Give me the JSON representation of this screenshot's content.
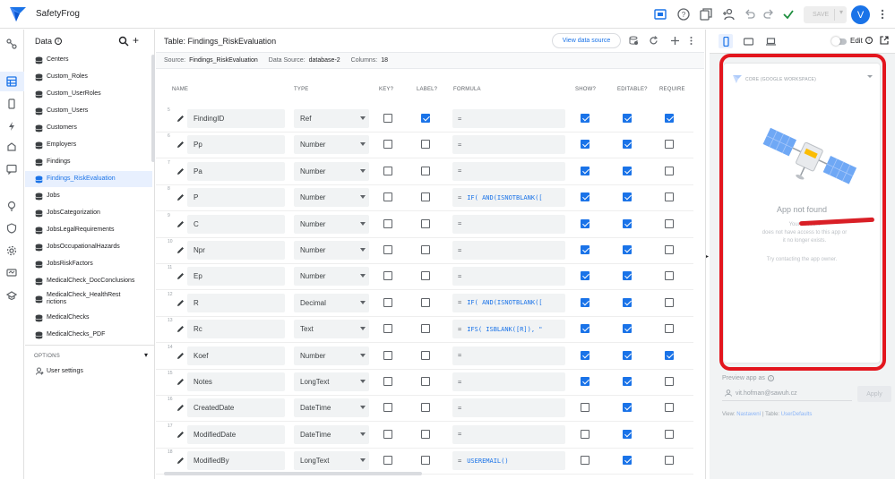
{
  "app": {
    "title": "SafetyFrog",
    "save_label": "SAVE",
    "avatar_letter": "V"
  },
  "data_panel": {
    "title": "Data",
    "tables": [
      "Centers",
      "Custom_Roles",
      "Custom_UserRoles",
      "Custom_Users",
      "Customers",
      "Employers",
      "Findings",
      "Findings_RiskEvaluation",
      "Jobs",
      "JobsCategorization",
      "JobsLegalRequirements",
      "JobsOccupationalHazards",
      "JobsRiskFactors",
      "MedicalCheck_DocConclusions",
      "MedicalCheck_HealthRestrictions",
      "MedicalChecks",
      "MedicalChecks_PDF"
    ],
    "active_table": "Findings_RiskEvaluation",
    "options_label": "OPTIONS",
    "user_settings_label": "User settings"
  },
  "main": {
    "title": "Table: Findings_RiskEvaluation",
    "view_source_label": "View data source",
    "source_label": "Source:",
    "source_value": "Findings_RiskEvaluation",
    "datasource_label": "Data Source:",
    "datasource_value": "database-2",
    "columns_label": "Columns:",
    "columns_value": "18",
    "headers": {
      "name": "NAME",
      "type": "TYPE",
      "key": "KEY?",
      "label": "LABEL?",
      "formula": "FORMULA",
      "show": "SHOW?",
      "editable": "EDITABLE?",
      "required": "REQUIRE"
    },
    "rows": [
      {
        "num": "5",
        "name": "FindingID",
        "type": "Ref",
        "key": false,
        "label": true,
        "formula": "",
        "show": true,
        "editable": true,
        "required": true
      },
      {
        "num": "6",
        "name": "Pp",
        "type": "Number",
        "key": false,
        "label": false,
        "formula": "",
        "show": true,
        "editable": true,
        "required": false
      },
      {
        "num": "7",
        "name": "Pa",
        "type": "Number",
        "key": false,
        "label": false,
        "formula": "",
        "show": true,
        "editable": true,
        "required": false
      },
      {
        "num": "8",
        "name": "P",
        "type": "Number",
        "key": false,
        "label": false,
        "formula": "IF(  AND(ISNOTBLANK([",
        "show": true,
        "editable": true,
        "required": false
      },
      {
        "num": "9",
        "name": "C",
        "type": "Number",
        "key": false,
        "label": false,
        "formula": "",
        "show": true,
        "editable": true,
        "required": false
      },
      {
        "num": "10",
        "name": "Npr",
        "type": "Number",
        "key": false,
        "label": false,
        "formula": "",
        "show": true,
        "editable": true,
        "required": false
      },
      {
        "num": "11",
        "name": "Ep",
        "type": "Number",
        "key": false,
        "label": false,
        "formula": "",
        "show": true,
        "editable": true,
        "required": false
      },
      {
        "num": "12",
        "name": "R",
        "type": "Decimal",
        "key": false,
        "label": false,
        "formula": "IF(  AND(ISNOTBLANK([",
        "show": true,
        "editable": true,
        "required": false
      },
      {
        "num": "13",
        "name": "Rc",
        "type": "Text",
        "key": false,
        "label": false,
        "formula": "IFS(  ISBLANK([R]), \"",
        "show": true,
        "editable": true,
        "required": false
      },
      {
        "num": "14",
        "name": "Koef",
        "type": "Number",
        "key": false,
        "label": false,
        "formula": "",
        "show": true,
        "editable": true,
        "required": true
      },
      {
        "num": "15",
        "name": "Notes",
        "type": "LongText",
        "key": false,
        "label": false,
        "formula": "",
        "show": true,
        "editable": true,
        "required": false
      },
      {
        "num": "16",
        "name": "CreatedDate",
        "type": "DateTime",
        "key": false,
        "label": false,
        "formula": "",
        "show": false,
        "editable": true,
        "required": false
      },
      {
        "num": "17",
        "name": "ModifiedDate",
        "type": "DateTime",
        "key": false,
        "label": false,
        "formula": "",
        "show": false,
        "editable": true,
        "required": false
      },
      {
        "num": "18",
        "name": "ModifiedBy",
        "type": "LongText",
        "key": false,
        "label": false,
        "formula": "USEREMAIL()",
        "show": false,
        "editable": true,
        "required": false
      }
    ]
  },
  "preview": {
    "edit_label": "Edit",
    "workspace_label": "CORE (GOOGLE WORKSPACE)",
    "not_found_title": "App not found",
    "not_found_msg_1": "Your account",
    "not_found_msg_2": "does not have access to this app or",
    "not_found_msg_3": "it no longer exists.",
    "contact_msg": "Try contacting the app owner.",
    "preview_as_label": "Preview app as",
    "email": "vit.hofman@sawuh.cz",
    "apply_label": "Apply",
    "view_label": "View:",
    "view_value": "Nastavení",
    "table_label": "Table:",
    "table_value": "UserDefaults"
  },
  "colors": {
    "accent": "#1a73e8",
    "annotation_red": "#e3161e",
    "active_bg": "#e8f0fe"
  }
}
